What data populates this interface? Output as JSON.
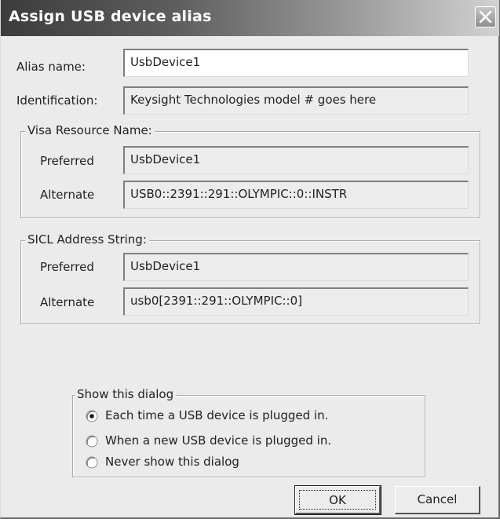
{
  "window": {
    "title": "Assign USB device alias"
  },
  "alias": {
    "label": "Alias name:",
    "value": "UsbDevice1"
  },
  "identification": {
    "label": "Identification:",
    "value": "Keysight Technologies model # goes here"
  },
  "visa": {
    "legend": "Visa Resource Name:",
    "preferred_label": "Preferred",
    "preferred_value": "UsbDevice1",
    "alternate_label": "Alternate",
    "alternate_value": "USB0::2391::291::OLYMPIC::0::INSTR"
  },
  "sicl": {
    "legend": "SICL Address String:",
    "preferred_label": "Preferred",
    "preferred_value": "UsbDevice1",
    "alternate_label": "Alternate",
    "alternate_value": "usb0[2391::291::OLYMPIC::0]"
  },
  "show_dialog": {
    "legend": "Show this dialog",
    "options": [
      {
        "label": "Each time a USB device is plugged in.",
        "selected": true
      },
      {
        "label": "When a new USB device is plugged in.",
        "selected": false
      },
      {
        "label": "Never show this dialog",
        "selected": false
      }
    ]
  },
  "buttons": {
    "ok": "OK",
    "cancel": "Cancel"
  },
  "icons": {
    "close": "close-icon",
    "radio_selected": "radio-selected-icon",
    "radio_unselected": "radio-unselected-icon"
  }
}
